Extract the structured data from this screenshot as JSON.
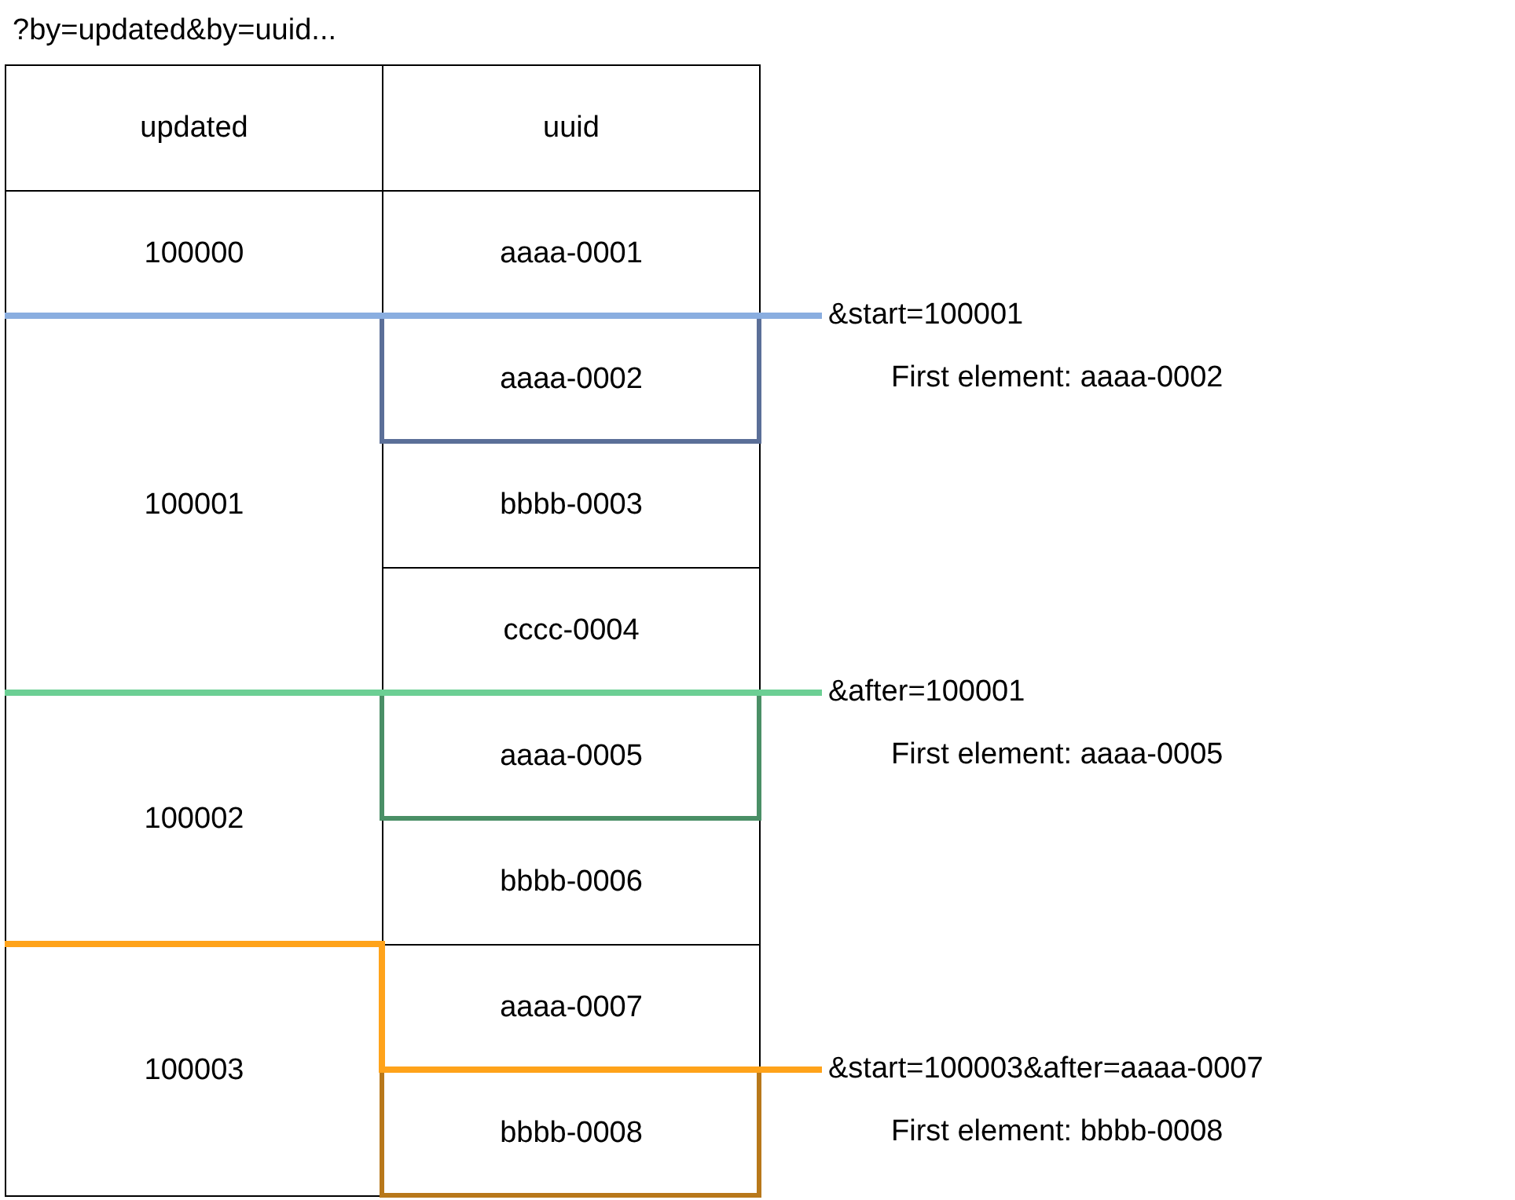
{
  "title": "?by=updated&by=uuid...",
  "columns": [
    "updated",
    "uuid"
  ],
  "groups": [
    {
      "updated": "100000",
      "rows": [
        {
          "uuid": "aaaa-0001"
        }
      ]
    },
    {
      "updated": "100001",
      "rows": [
        {
          "uuid": "aaaa-0002",
          "cursor": {
            "kind": "straight",
            "line": {
              "color": "#8aaee0"
            },
            "box": {
              "color": "#5b6f98"
            },
            "query": "&start=100001",
            "note": "First element: aaaa-0002"
          }
        },
        {
          "uuid": "bbbb-0003"
        },
        {
          "uuid": "cccc-0004"
        }
      ]
    },
    {
      "updated": "100002",
      "rows": [
        {
          "uuid": "aaaa-0005",
          "cursor": {
            "kind": "straight",
            "line": {
              "color": "#6ccf94"
            },
            "box": {
              "color": "#4a8f66"
            },
            "query": "&after=100001",
            "note": "First element: aaaa-0005"
          }
        },
        {
          "uuid": "bbbb-0006"
        }
      ]
    },
    {
      "updated": "100003",
      "rows": [
        {
          "uuid": "aaaa-0007"
        },
        {
          "uuid": "bbbb-0008",
          "cursor": {
            "kind": "step",
            "line": {
              "color": "#ffa31a"
            },
            "box": {
              "color": "#b8781a"
            },
            "query": "&start=100003&after=aaaa-0007",
            "note": "First element: bbbb-0008"
          }
        }
      ]
    }
  ]
}
